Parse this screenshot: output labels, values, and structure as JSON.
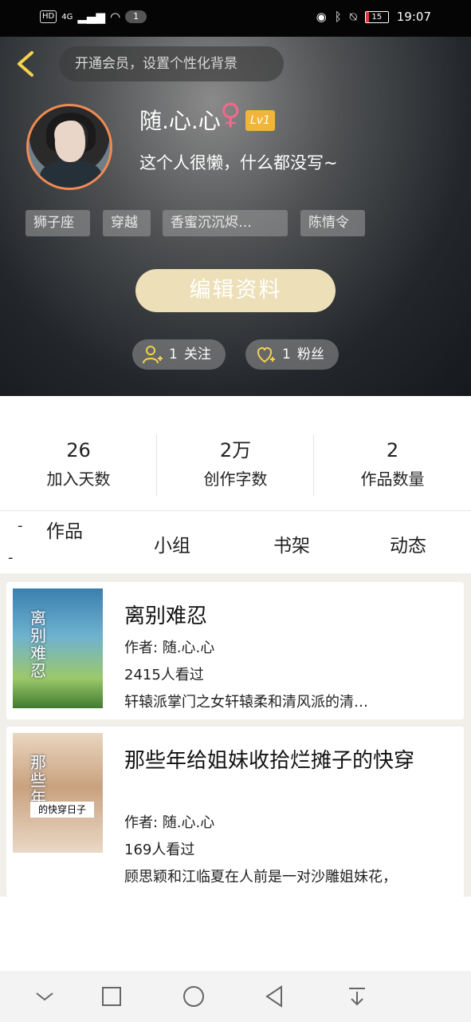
{
  "status_bar": {
    "network": "HD",
    "signal": "4G",
    "notification_count": "1",
    "battery": "15",
    "battery_level": 0.15,
    "time": "19:07"
  },
  "header": {
    "member_prompt": "开通会员，设置个性化背景",
    "username": "随.心.心",
    "gender_symbol": "♀",
    "level": "Lv1",
    "bio": "这个人很懒，什么都没写~",
    "tags": [
      "狮子座",
      "穿越",
      "香蜜沉沉烬…",
      "陈情令"
    ],
    "edit_button": "编辑资料",
    "follow_count": "1",
    "follow_label": "关注",
    "fans_count": "1",
    "fans_label": "粉丝"
  },
  "stats": [
    {
      "value": "26",
      "label": "加入天数"
    },
    {
      "value": "2万",
      "label": "创作字数"
    },
    {
      "value": "2",
      "label": "作品数量"
    }
  ],
  "tabs": [
    "作品",
    "小组",
    "书架",
    "动态"
  ],
  "books": [
    {
      "cover_title": "离别难忍",
      "title": "离别难忍",
      "author": "作者: 随.心.心",
      "views": "2415人看过",
      "desc": "轩辕派掌门之女轩辕柔和清风派的清…"
    },
    {
      "cover_title": "那些年",
      "cover_subtitle": "的快穿日子",
      "title": "那些年给姐妹收拾烂摊子的快穿",
      "author": "作者: 随.心.心",
      "views": "169人看过",
      "desc": "顾思颖和江临夏在人前是一对沙雕姐妹花，"
    }
  ],
  "colors": {
    "accent_yellow": "#f5d24a",
    "level_badge": "#f2b53c",
    "edit_button": "#ede0b8",
    "avatar_border": "#f08a54"
  }
}
